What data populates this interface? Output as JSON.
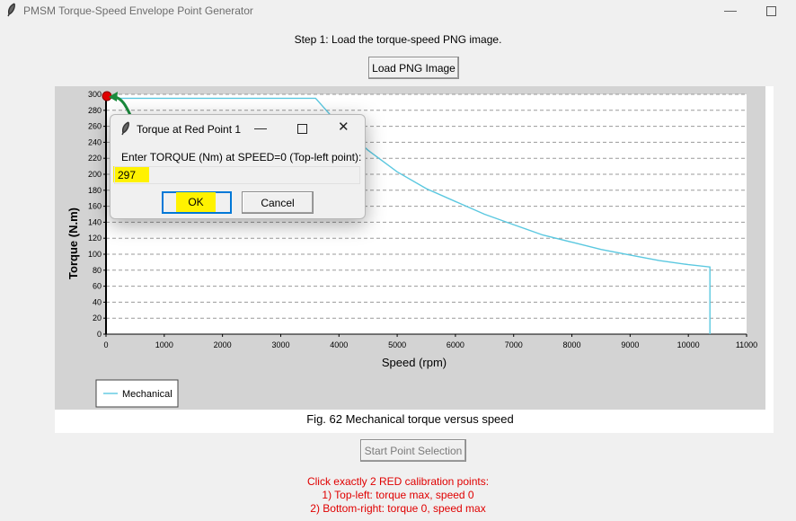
{
  "window": {
    "title": "PMSM Torque-Speed Envelope Point Generator",
    "minimize": "—"
  },
  "step_label": "Step 1: Load the torque-speed PNG image.",
  "load_button": "Load PNG Image",
  "figure": {
    "caption": "Fig. 62 Mechanical torque versus speed"
  },
  "chart_data": {
    "type": "line",
    "xlabel": "Speed (rpm)",
    "ylabel": "Torque (N.m)",
    "xlim": [
      0,
      11000
    ],
    "ylim": [
      0,
      300
    ],
    "xticks": [
      0,
      1000,
      2000,
      3000,
      4000,
      5000,
      6000,
      7000,
      8000,
      9000,
      10000,
      11000
    ],
    "yticks": [
      0,
      20,
      40,
      60,
      80,
      100,
      120,
      140,
      160,
      180,
      200,
      220,
      240,
      260,
      280,
      300
    ],
    "grid": "horizontal dashed",
    "legend_position": "bottom-left",
    "series": [
      {
        "name": "Mechanical",
        "color": "#5bc8e0",
        "x": [
          0,
          3600,
          4000,
          4500,
          5000,
          5500,
          6000,
          6500,
          7000,
          7500,
          8000,
          8500,
          9000,
          9500,
          10000,
          10370,
          10370
        ],
        "y": [
          295,
          295,
          262,
          230,
          203,
          182,
          166,
          150,
          137,
          124,
          115,
          106,
          99,
          92,
          87,
          84,
          0
        ]
      }
    ],
    "calibration_marker": {
      "x": 0,
      "y": 300,
      "color": "#e00000"
    }
  },
  "start_button": "Start Point Selection",
  "instructions": [
    "Click exactly 2 RED calibration points:",
    "1) Top-left: torque max, speed 0",
    "2) Bottom-right: torque 0, speed max"
  ],
  "dialog": {
    "title": "Torque at Red Point 1",
    "prompt": "Enter TORQUE (Nm) at SPEED=0 (Top-left point):",
    "input_value": "297",
    "ok_label": "OK",
    "cancel_label": "Cancel",
    "highlight_color": "#fff200"
  }
}
